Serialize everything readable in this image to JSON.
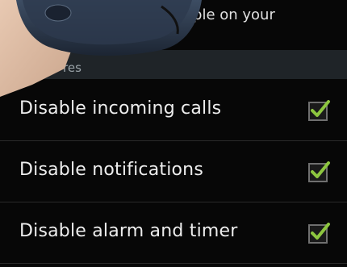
{
  "top_text": "ople on your",
  "section_header": "res",
  "rows": [
    {
      "label": "Disable incoming calls",
      "checked": true
    },
    {
      "label": "Disable notifications",
      "checked": true
    },
    {
      "label": "Disable alarm and timer",
      "checked": true
    }
  ],
  "colors": {
    "check": "#8dc63f",
    "section": "#1f2428"
  }
}
